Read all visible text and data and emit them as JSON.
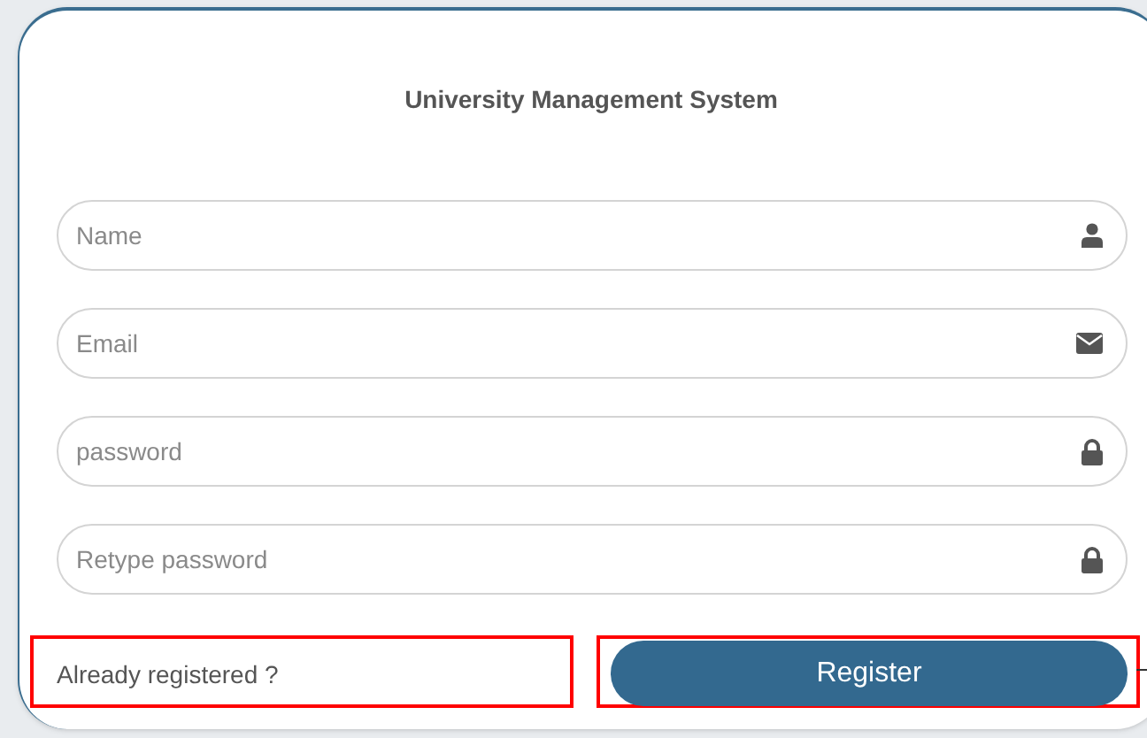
{
  "title": "University Management System",
  "fields": [
    {
      "placeholder": "Name",
      "kind": "user"
    },
    {
      "placeholder": "Email",
      "kind": "email"
    },
    {
      "placeholder": "password",
      "kind": "password"
    },
    {
      "placeholder": "Retype password",
      "kind": "password"
    }
  ],
  "login_link": "Already registered ?",
  "register_button": "Register"
}
